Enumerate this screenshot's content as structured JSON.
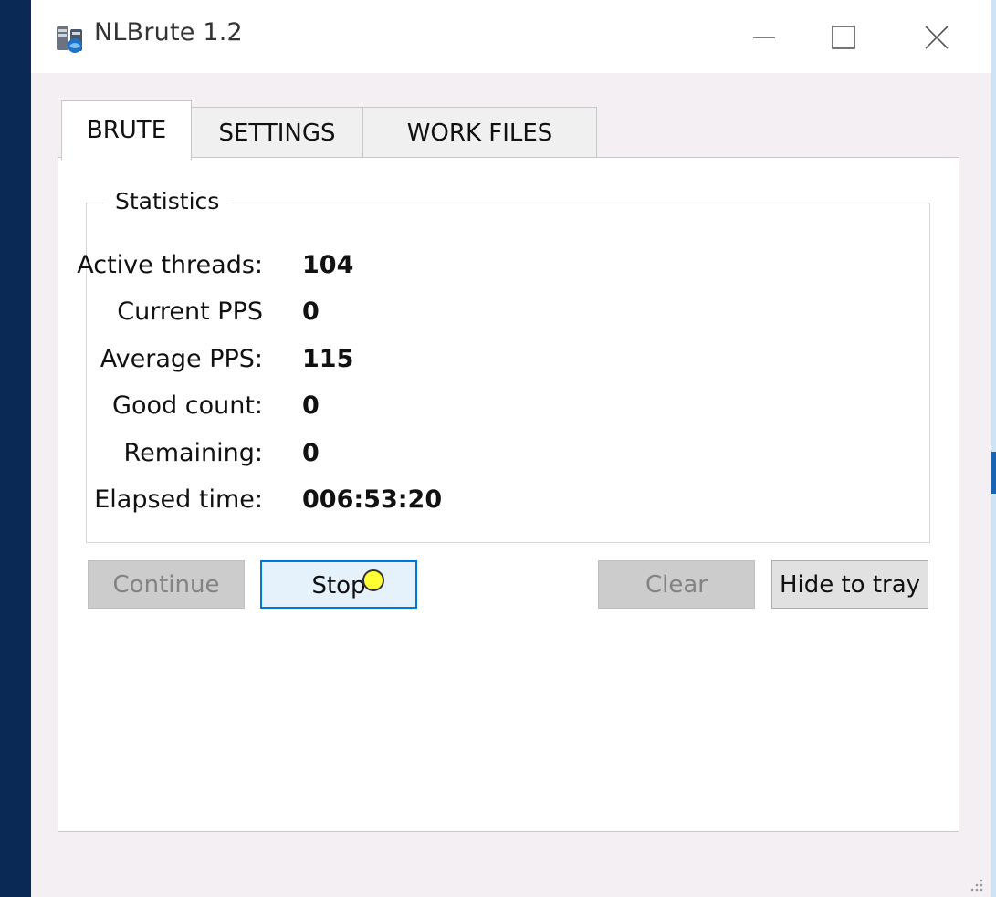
{
  "window": {
    "title": "NLBrute 1.2",
    "icon": "nlbrute-app-icon",
    "controls": {
      "minimize": "minimize-icon",
      "maximize": "maximize-icon",
      "close": "close-icon"
    }
  },
  "tabs": [
    {
      "label": "BRUTE",
      "active": true
    },
    {
      "label": "SETTINGS",
      "active": false
    },
    {
      "label": "WORK FILES",
      "active": false
    }
  ],
  "statistics": {
    "title": "Statistics",
    "rows": [
      {
        "label": "Active threads:",
        "value": "104"
      },
      {
        "label": "Current PPS",
        "value": "0"
      },
      {
        "label": "Average PPS:",
        "value": "115"
      },
      {
        "label": "Good count:",
        "value": "0"
      },
      {
        "label": "Remaining:",
        "value": "0"
      },
      {
        "label": "Elapsed time:",
        "value": "006:53:20"
      }
    ]
  },
  "buttons": {
    "continue": {
      "label": "Continue",
      "enabled": false
    },
    "stop": {
      "label": "Stop",
      "enabled": true,
      "focused": true
    },
    "clear": {
      "label": "Clear",
      "enabled": false
    },
    "hide_to_tray": {
      "label": "Hide to tray",
      "enabled": true
    }
  },
  "colors": {
    "focus_border": "#0078d7",
    "desktop_edge": "#0a2a55",
    "cursor_highlight": "#ffff33"
  }
}
